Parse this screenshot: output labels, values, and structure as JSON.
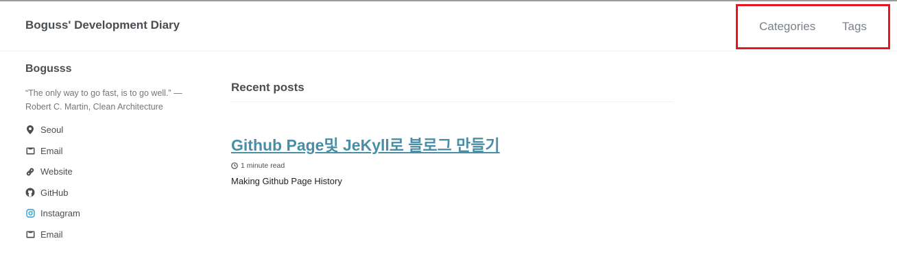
{
  "header": {
    "site_title": "Boguss' Development Diary",
    "nav": [
      {
        "label": "Categories"
      },
      {
        "label": "Tags"
      }
    ],
    "highlight_color": "#e8141e"
  },
  "sidebar": {
    "author_name": "Bogusss",
    "bio": "“The only way to go fast, is to go well.” — Robert C. Martin, Clean Architecture",
    "links": [
      {
        "icon": "map-marker-icon",
        "label": "Seoul"
      },
      {
        "icon": "envelope-icon",
        "label": "Email"
      },
      {
        "icon": "link-icon",
        "label": "Website"
      },
      {
        "icon": "github-icon",
        "label": "GitHub"
      },
      {
        "icon": "instagram-icon",
        "label": "Instagram"
      },
      {
        "icon": "envelope-icon",
        "label": "Email"
      }
    ]
  },
  "main": {
    "section_title": "Recent posts",
    "posts": [
      {
        "title": "Github Page및 JeKyll로 블로그 만들기",
        "read_time": "1 minute read",
        "excerpt": "Making Github Page History"
      }
    ]
  }
}
